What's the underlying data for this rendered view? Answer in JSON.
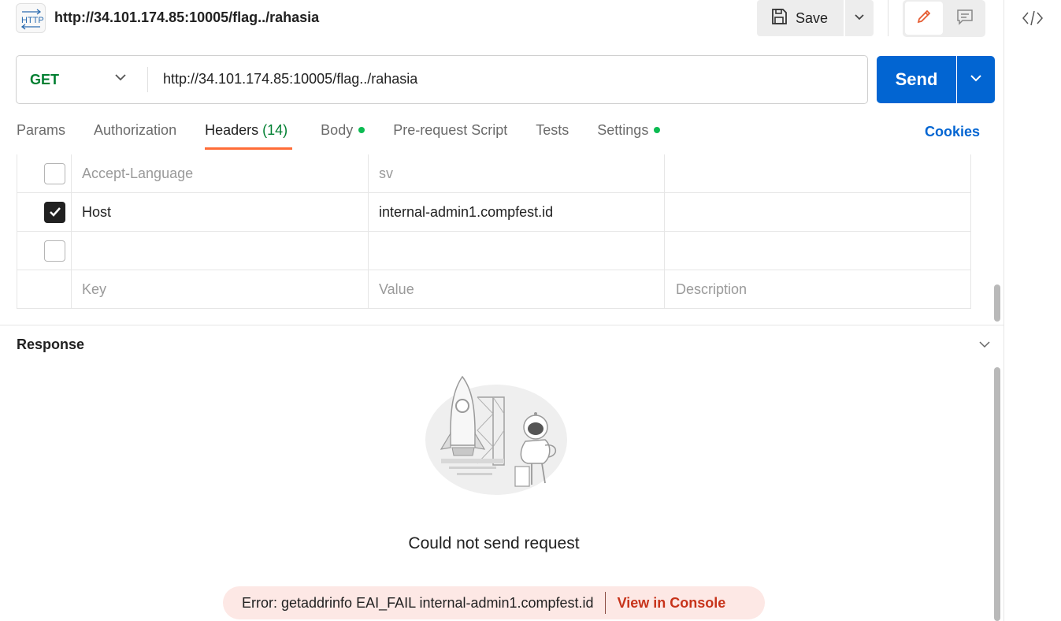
{
  "request": {
    "title": "http://34.101.174.85:10005/flag../rahasia",
    "method": "GET",
    "url": "http://34.101.174.85:10005/flag../rahasia",
    "icon": "http-icon"
  },
  "toolbar": {
    "save_label": "Save",
    "send_label": "Send",
    "cookies_label": "Cookies"
  },
  "tabs": [
    {
      "label": "Params",
      "count": "",
      "dot": false,
      "active": false
    },
    {
      "label": "Authorization",
      "count": "",
      "dot": false,
      "active": false
    },
    {
      "label": "Headers",
      "count": "(14)",
      "dot": false,
      "active": true
    },
    {
      "label": "Body",
      "count": "",
      "dot": true,
      "active": false
    },
    {
      "label": "Pre-request Script",
      "count": "",
      "dot": false,
      "active": false
    },
    {
      "label": "Tests",
      "count": "",
      "dot": false,
      "active": false
    },
    {
      "label": "Settings",
      "count": "",
      "dot": true,
      "active": false
    }
  ],
  "headers_table": {
    "rows": [
      {
        "checked": false,
        "key": "Accept-Language",
        "value": "sv",
        "description": ""
      },
      {
        "checked": true,
        "key": "Host",
        "value": "internal-admin1.compfest.id",
        "description": ""
      },
      {
        "checked": false,
        "key": "",
        "value": "",
        "description": ""
      }
    ],
    "placeholders": {
      "key": "Key",
      "value": "Value",
      "description": "Description"
    }
  },
  "response": {
    "title": "Response",
    "error_title": "Could not send request",
    "error_message": "Error: getaddrinfo EAI_FAIL internal-admin1.compfest.id",
    "console_link": "View in Console"
  },
  "colors": {
    "accent_blue": "#0265d2",
    "method_green": "#007f31",
    "tab_underline": "#ff6c37",
    "status_dot": "#0cbb52",
    "error_bg": "#fde8e5",
    "error_link": "#c7331a"
  }
}
